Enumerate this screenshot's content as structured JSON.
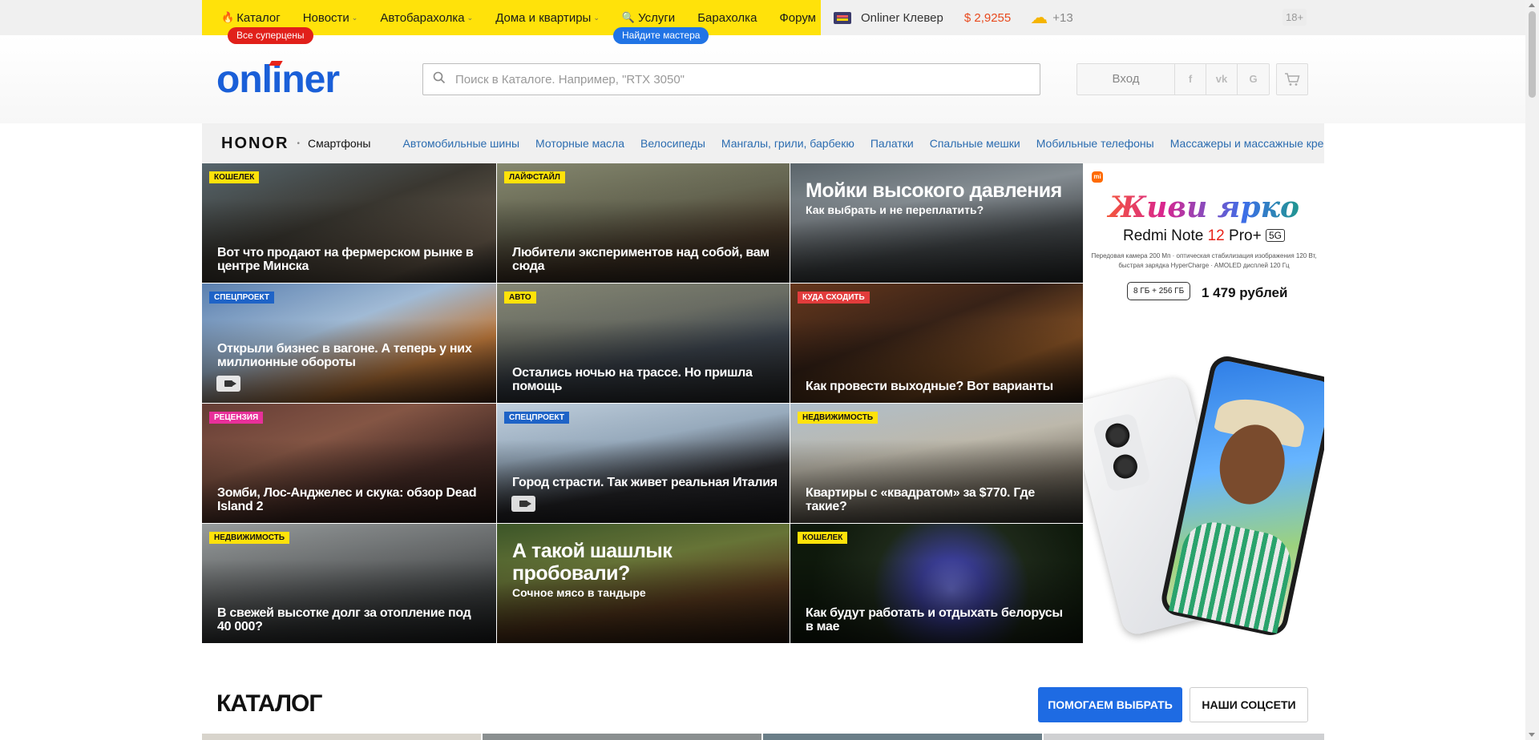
{
  "topnav": {
    "items": [
      {
        "label": "Каталог",
        "icon": "fire-icon"
      },
      {
        "label": "Новости",
        "chevron": true
      },
      {
        "label": "Автобарахолка",
        "chevron": true
      },
      {
        "label": "Дома и квартиры",
        "chevron": true
      },
      {
        "label": "Услуги",
        "icon": "magnifier-icon"
      },
      {
        "label": "Барахолка"
      },
      {
        "label": "Форум"
      }
    ],
    "catalog_badge": "Все суперцены",
    "services_badge": "Найдите мастера",
    "clever": "Onliner Клевер",
    "rate": "$ 2,9255",
    "temperature": "+13",
    "age": "18+"
  },
  "header": {
    "logo": "onliner",
    "search_placeholder": "Поиск в Каталоге. Например, \"RTX 3050\"",
    "login": "Вход",
    "social": [
      "f",
      "vk",
      "G"
    ]
  },
  "categories": {
    "brand": "HONOR",
    "brand_category": "Смартфоны",
    "links": [
      "Автомобильные шины",
      "Моторные масла",
      "Велосипеды",
      "Мангалы, грили, барбекю",
      "Палатки",
      "Спальные мешки",
      "Мобильные телефоны",
      "Массажеры и массажные кре"
    ]
  },
  "news": [
    {
      "tag": "КОШЕЛЕК",
      "tag_style": "yellow",
      "title": "Вот что продают на фермерском рынке в центре Минска",
      "bg": "linear-gradient(160deg,#5a6a72,#3d3a33 45%,#6e6050 80%,#2d2a26)"
    },
    {
      "tag": "ЛАЙФСТАЙЛ",
      "tag_style": "yellow",
      "title": "Любители экспериментов над собой, вам сюда",
      "bg": "linear-gradient(170deg,#8b8e74,#6a6a55 40%,#4a3a2a 70%,#2c2620)"
    },
    {
      "tag": "",
      "tag_style": "",
      "big_title": "Мойки высокого давления",
      "big_sub": "Как выбрать и не переплатить?",
      "bg": "linear-gradient(170deg,#5f6a70,#8c949a 35%,#4a4f52 65%,#2c2f30)"
    },
    {
      "tag": "СПЕЦПРОЕКТ",
      "tag_style": "blue",
      "title": "Открыли бизнес в вагоне. А теперь у них миллионные обороты",
      "video": true,
      "bg": "linear-gradient(160deg,#5f86b8,#a9c4e0 40%,#c9803f 70%,#4c2c1a)"
    },
    {
      "tag": "АВТО",
      "tag_style": "yellow",
      "title": "Остались ночью на трассе. Но пришла помощь",
      "bg": "linear-gradient(170deg,#8b8d7a,#6f7268 35%,#3e4650 60%,#2a2b2c)"
    },
    {
      "tag": "КУДА СХОДИТЬ",
      "tag_style": "red",
      "title": "Как провести выходные? Вот варианты",
      "bg": "linear-gradient(160deg,#6b3a1e,#3a2418 40%,#8a5426 70%,#2a1a10)"
    },
    {
      "tag": "РЕЦЕНЗИЯ",
      "tag_style": "pink",
      "title": "Зомби, Лос-Анджелес и скука: обзор Dead Island 2",
      "bg": "linear-gradient(160deg,#6a4038,#8b5a48 35%,#4a2e28 65%,#2a1a16)"
    },
    {
      "tag": "СПЕЦПРОЕКТ",
      "tag_style": "blue",
      "title": "Город страсти. Так живет реальная Италия",
      "video": true,
      "bg": "linear-gradient(170deg,#c9d9e8,#9fb3c6 35%,#2c2c30 65%,#1c1c20)"
    },
    {
      "tag": "НЕДВИЖИМОСТЬ",
      "tag_style": "yellow",
      "title": "Квартиры с «квадратом» за $770. Где такие?",
      "bg": "linear-gradient(170deg,#b8c8d6,#c7c2b4 40%,#7b7366 70%,#3a3a34)"
    },
    {
      "tag": "НЕДВИЖИМОСТЬ",
      "tag_style": "yellow",
      "title": "В свежей высотке долг за отопление под 40 000?",
      "bg": "linear-gradient(170deg,#9ea3a4,#6c6f70 40%,#3c3f40 70%,#1f2122)"
    },
    {
      "tag": "",
      "tag_style": "",
      "big_title": "А такой шашлык пробовали?",
      "big_sub": "Сочное мясо в тандыре",
      "bg": "linear-gradient(170deg,#3f5a2a,#6c7a3a 35%,#5a3a1e 65%,#2a1a10)"
    },
    {
      "tag": "КОШЕЛЕК",
      "tag_style": "yellow",
      "title": "Как будут работать и отдыхать белорусы в мае",
      "bg": "radial-gradient(circle at 55% 55%,#6a6fd0 0,#3c3f9a 18%,#1e2a1a 45%,#0f1a0c 80%)"
    }
  ],
  "ad": {
    "brand": "mi",
    "slogan": "Живи ярко",
    "model_prefix": "Redmi Note ",
    "model_num": "12",
    "model_suffix": " Pro+",
    "model_badge": "5G",
    "spec": "Передовая камера 200 Мп · оптическая стабилизация изображения 120 Вт, быстрая зарядка HyperCharge · AMOLED дисплей 120 Гц",
    "memory": "8 ГБ + 256 ГБ",
    "price": "1 479 рублей"
  },
  "catalog": {
    "title": "КАТАЛОГ",
    "help_button": "ПОМОГАЕМ ВЫБРАТЬ",
    "social_button": "НАШИ СОЦСЕТИ"
  },
  "colors": {
    "brand_yellow": "#ffe20a",
    "brand_blue": "#1a5fd8",
    "accent_red": "#e8491d"
  }
}
